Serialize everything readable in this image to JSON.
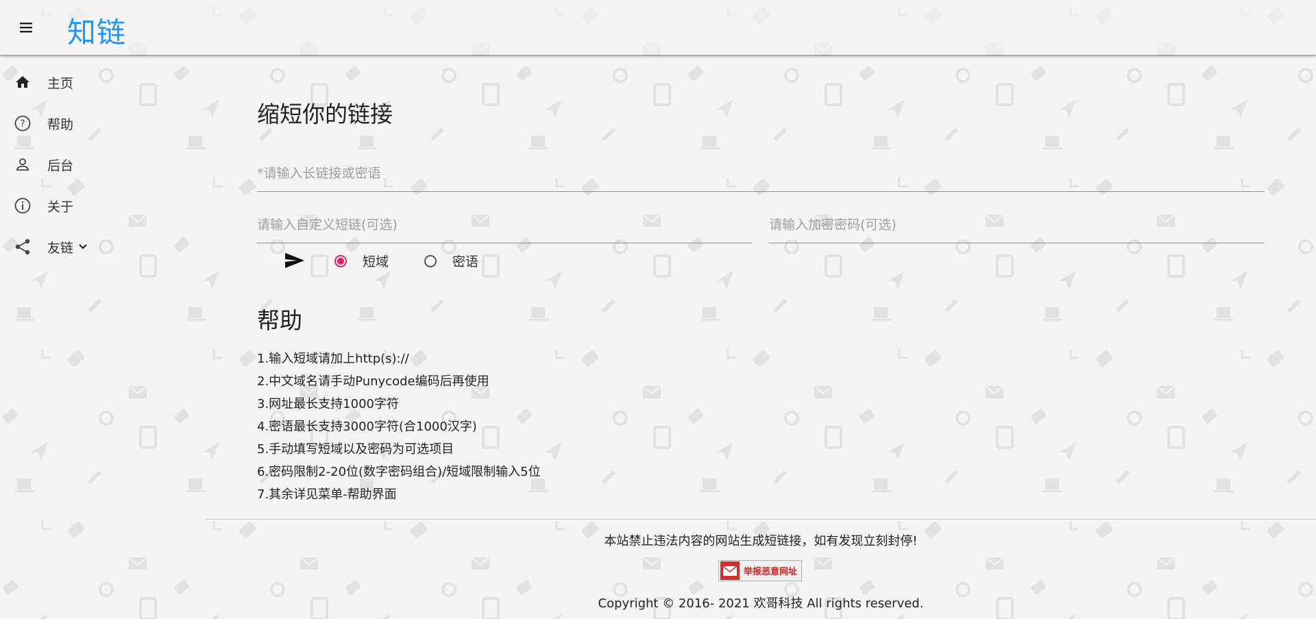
{
  "app": {
    "brand": "知链"
  },
  "sidebar": {
    "items": [
      {
        "label": "主页",
        "icon": "home-icon"
      },
      {
        "label": "帮助",
        "icon": "help-circle-icon"
      },
      {
        "label": "后台",
        "icon": "person-icon"
      },
      {
        "label": "关于",
        "icon": "info-icon"
      },
      {
        "label": "友链",
        "icon": "share-icon"
      }
    ]
  },
  "form": {
    "title": "缩短你的链接",
    "long_placeholder": "*请输入长链接或密语",
    "custom_placeholder": "请输入自定义短链(可选)",
    "password_placeholder": "请输入加密密码(可选)",
    "send_icon": "send-icon",
    "radios": [
      {
        "label": "短域",
        "checked": true
      },
      {
        "label": "密语",
        "checked": false
      }
    ],
    "accent_color": "#e91e63"
  },
  "help": {
    "title": "帮助",
    "items": [
      "1.输入短域请加上http(s)://",
      "2.中文域名请手动Punycode编码后再使用",
      "3.网址最长支持1000字符",
      "4.密语最长支持3000字符(合1000汉字)",
      "5.手动填写短域以及密码为可选项目",
      "6.密码限制2-20位(数字密码组合)/短域限制输入5位",
      "7.其余详见菜单-帮助界面"
    ]
  },
  "footer": {
    "notice": "本站禁止违法内容的网站生成短链接，如有发现立刻封停!",
    "report_label": "举报恶意网址",
    "copyright": "Copyright © 2016- 2021 欢哥科技 All rights reserved."
  },
  "colors": {
    "brand": "#2196f3",
    "background": "#f4f4f4"
  }
}
